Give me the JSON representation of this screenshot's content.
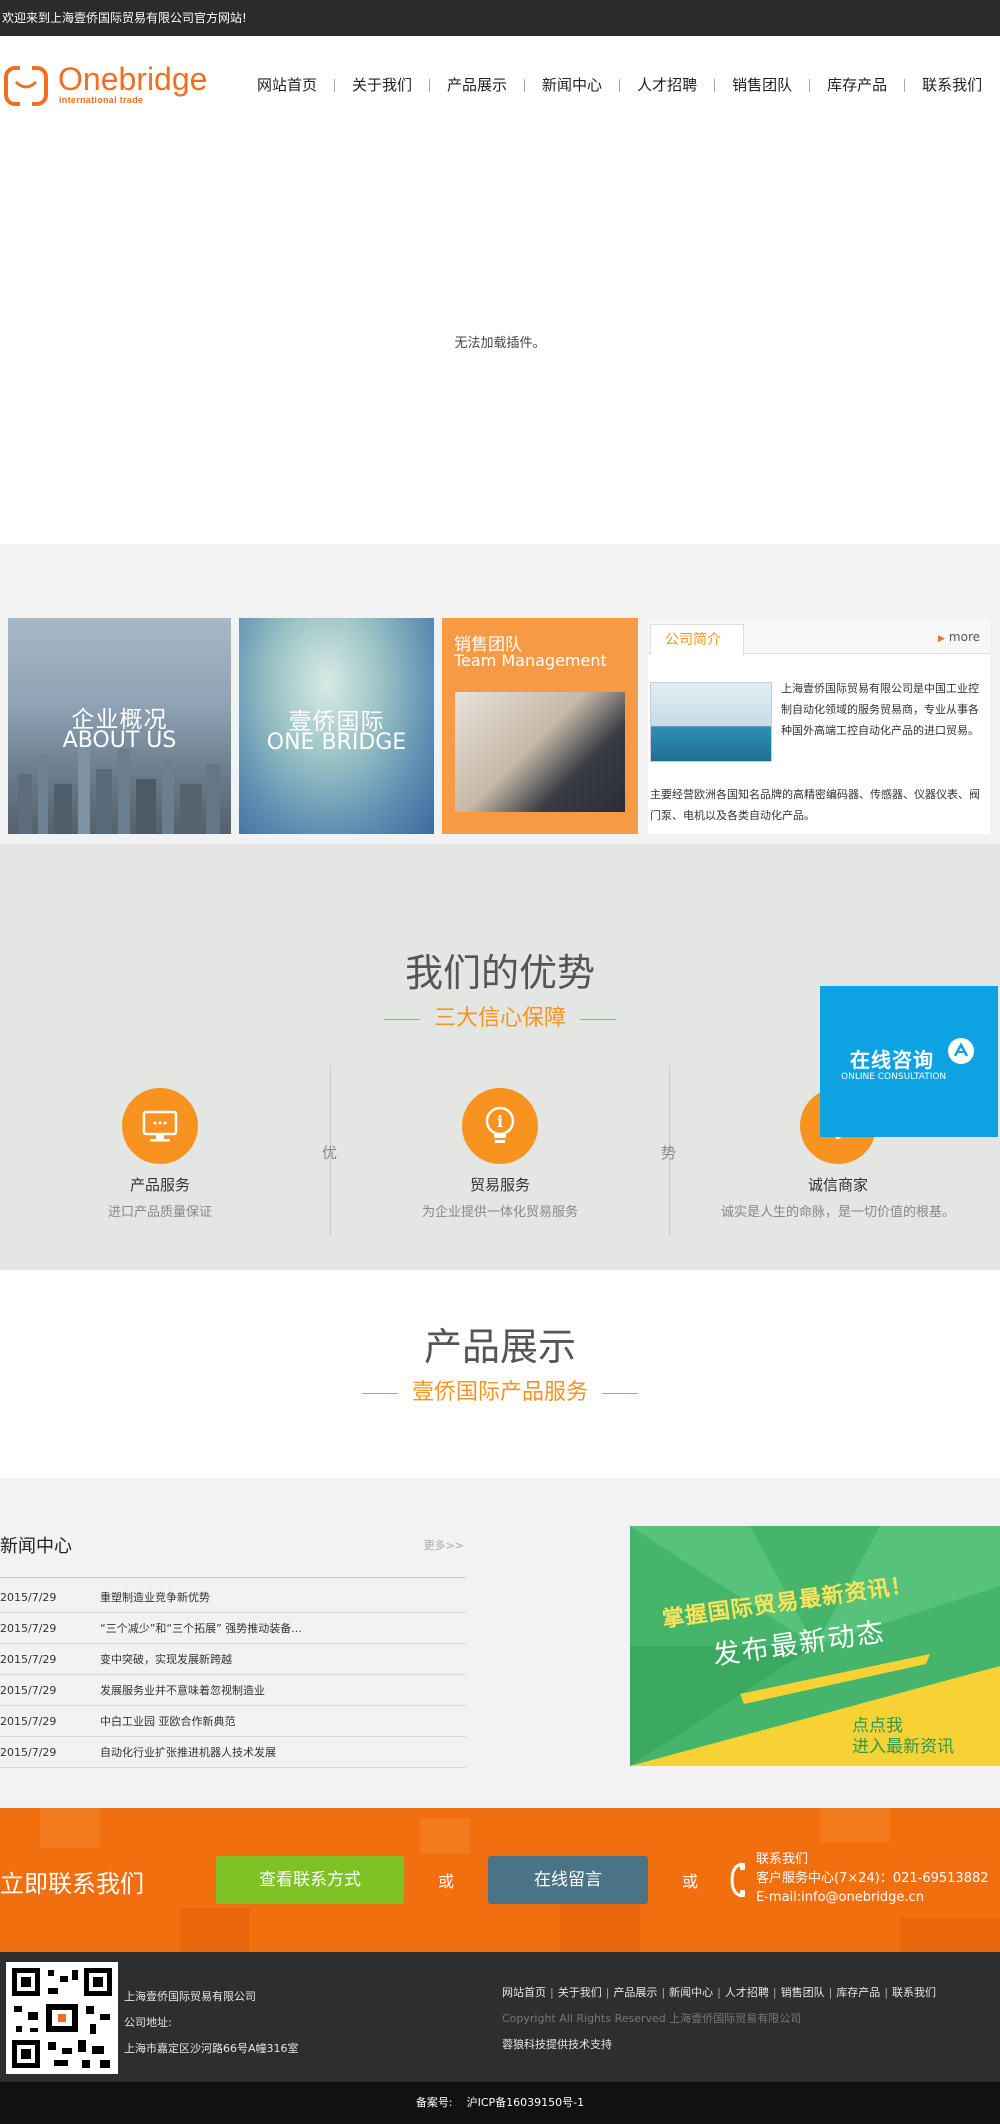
{
  "topbar": {
    "welcome": "欢迎来到上海壹侨国际贸易有限公司官方网站!"
  },
  "header": {
    "logo_name": "Onebridge",
    "logo_sub": "international trade",
    "nav": [
      "网站首页",
      "关于我们",
      "产品展示",
      "新闻中心",
      "人才招聘",
      "销售团队",
      "库存产品",
      "联系我们"
    ]
  },
  "banner": {
    "message": "无法加载插件。"
  },
  "about": {
    "tile1": {
      "cn": "企业概况",
      "en": "ABOUT US"
    },
    "tile2": {
      "cn": "壹侨国际",
      "en": "ONE BRIDGE"
    },
    "tile3": {
      "cn": "销售团队",
      "en": "Team Management"
    },
    "intro": {
      "tab": "公司简介",
      "more": "more",
      "text_a": "上海壹侨国际贸易有限公司是中国工业控制自动化领域的服务贸易商，专业从事各种国外高端工控自动化产品的进口贸易。",
      "text_b": "主要经营欧洲各国知名品牌的高精密编码器、传感器、仪器仪表、阀门泵、电机以及各类自动化产品。"
    }
  },
  "advantages": {
    "title": "我们的优势",
    "subtitle": "三大信心保障",
    "divider_chars": [
      "优",
      "势"
    ],
    "items": [
      {
        "name": "产品服务",
        "desc": "进口产品质量保证",
        "icon": "monitor-icon"
      },
      {
        "name": "贸易服务",
        "desc": "为企业提供一体化贸易服务",
        "icon": "lightbulb-icon"
      },
      {
        "name": "诚信商家",
        "desc": "诚实是人生的命脉，是一切价值的根基。",
        "icon": "handshake-icon"
      }
    ]
  },
  "float_chat": {
    "cn": "在线咨询",
    "en": "ONLINE CONSULTATION"
  },
  "products": {
    "title": "产品展示",
    "subtitle": "壹侨国际产品服务"
  },
  "news": {
    "title": "新闻中心",
    "more": "更多>>",
    "items": [
      {
        "date": "2015/7/29",
        "text": "重塑制造业竞争新优势"
      },
      {
        "date": "2015/7/29",
        "text": "“三个减少”和“三个拓展” 强势推动装备..."
      },
      {
        "date": "2015/7/29",
        "text": "变中突破，实现发展新跨越"
      },
      {
        "date": "2015/7/29",
        "text": "发展服务业并不意味着忽视制造业"
      },
      {
        "date": "2015/7/29",
        "text": "中白工业园 亚欧合作新典范"
      },
      {
        "date": "2015/7/29",
        "text": "自动化行业扩张推进机器人技术发展"
      }
    ],
    "ad": {
      "line1": "掌握国际贸易最新资讯！",
      "line2": "发布最新动态",
      "line3": "点点我",
      "line4": "进入最新资讯"
    }
  },
  "contact": {
    "title": "立即联系我们",
    "btn_contact": "查看联系方式",
    "or": "或",
    "btn_message": "在线留言",
    "info": [
      "联系我们",
      "客户服务中心(7×24)：021-69513882",
      "E-mail:info@onebridge.cn"
    ]
  },
  "footer": {
    "company": "上海壹侨国际贸易有限公司",
    "address_label": "公司地址:",
    "address": "上海市嘉定区沙河路66号A幢316室",
    "nav": [
      "网站首页",
      "关于我们",
      "产品展示",
      "新闻中心",
      "人才招聘",
      "销售团队",
      "库存产品",
      "联系我们"
    ],
    "copyright": "Copyright All Rights Reserved 上海壹侨国际贸易有限公司",
    "support": "蓉狼科技提供技术支持"
  },
  "icp": {
    "label": "备案号:",
    "value": "沪ICP备16039150号-1"
  },
  "colors": {
    "brand": "#f26f21",
    "accent": "#f7931e",
    "chat": "#0da3e2",
    "green_button": "#7ec224",
    "blue_button": "#4a7486"
  }
}
